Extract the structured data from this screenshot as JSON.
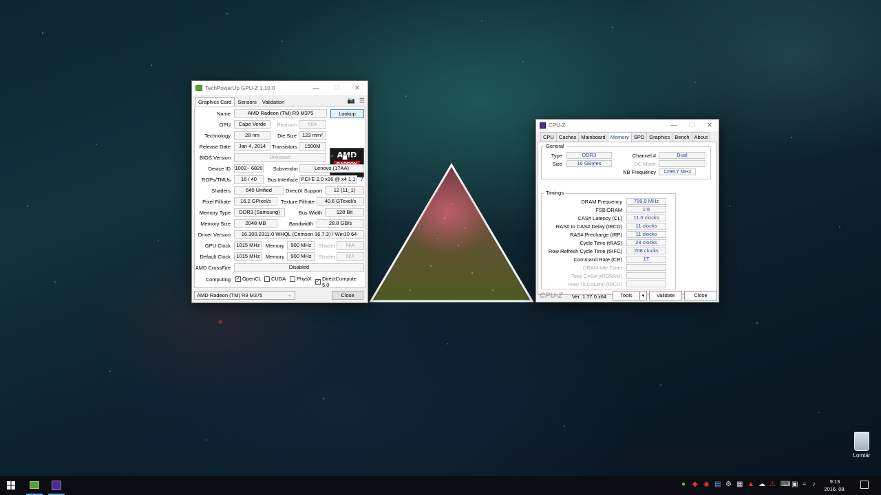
{
  "desktop": {
    "recycle_label": "Lomtár"
  },
  "gpuz": {
    "title": "TechPowerUp GPU-Z 1.10.0",
    "tabs": [
      "Graphics Card",
      "Sensors",
      "Validation"
    ],
    "lookup": "Lookup",
    "uefi": "UEFI",
    "rows": {
      "name": {
        "label": "Name",
        "value": "AMD Radeon (TM) R9 M375"
      },
      "gpu": {
        "label": "GPU",
        "value": "Cape Verde",
        "label2": "Revision",
        "value2": "N/A"
      },
      "technology": {
        "label": "Technology",
        "value": "28 nm",
        "label2": "Die Size",
        "value2": "123 mm²"
      },
      "release": {
        "label": "Release Date",
        "value": "Jan 4, 2014",
        "label2": "Transistors",
        "value2": "1500M"
      },
      "bios": {
        "label": "BIOS Version",
        "value": "Unknown"
      },
      "device": {
        "label": "Device ID",
        "value": "1002 - 6820",
        "label2": "Subvendor",
        "value2": "Lenovo (17AA)"
      },
      "rops": {
        "label": "ROPs/TMUs",
        "value": "16 / 40",
        "label2": "Bus Interface",
        "value2": "PCI-E 2.0 x16 @ x4 1.1",
        "help": "?"
      },
      "shaders": {
        "label": "Shaders",
        "value": "640 Unified",
        "label2": "DirectX Support",
        "value2": "12 (11_1)"
      },
      "pixel": {
        "label": "Pixel Fillrate",
        "value": "16.2 GPixel/s",
        "label2": "Texture Fillrate",
        "value2": "40.6 GTexel/s"
      },
      "memtype": {
        "label": "Memory Type",
        "value": "DDR3 (Samsung)",
        "label2": "Bus Width",
        "value2": "128 Bit"
      },
      "memsize": {
        "label": "Memory Size",
        "value": "2048 MB",
        "label2": "Bandwidth",
        "value2": "28.8 GB/s"
      },
      "driver": {
        "label": "Driver Version",
        "value": "16.300.2311.0 WHQL (Crimson 16.7.3) / Win10 64"
      },
      "gpuclock": {
        "label": "GPU Clock",
        "value": "1015 MHz",
        "label2": "Memory",
        "value2": "900 MHz",
        "label3": "Shader",
        "value3": "N/A"
      },
      "defclock": {
        "label": "Default Clock",
        "value": "1015 MHz",
        "label2": "Memory",
        "value2": "900 MHz",
        "label3": "Shader",
        "value3": "N/A"
      },
      "crossfire": {
        "label": "AMD CrossFire",
        "value": "Disabled"
      },
      "computing": {
        "label": "Computing",
        "opencl": "OpenCL",
        "cuda": "CUDA",
        "physx": "PhysX",
        "dc": "DirectCompute 5.0"
      }
    },
    "logo": {
      "brand": "AMD",
      "line1": "RADEON",
      "line2": "GRAPHICS"
    },
    "selected_card": "AMD Radeon (TM) R9 M375",
    "close": "Close"
  },
  "cpuz": {
    "title": "CPU-Z",
    "tabs": [
      "CPU",
      "Caches",
      "Mainboard",
      "Memory",
      "SPD",
      "Graphics",
      "Bench",
      "About"
    ],
    "general": {
      "title": "General",
      "type_label": "Type",
      "type": "DDR3",
      "size_label": "Size",
      "size": "16 GBytes",
      "channel_label": "Channel #",
      "channel": "Dual",
      "dc_label": "DC Mode",
      "dc": "",
      "nb_label": "NB Frequency",
      "nb": "1299.7 MHz"
    },
    "timings": {
      "title": "Timings",
      "rows": [
        {
          "label": "DRAM Frequency",
          "value": "799.9 MHz"
        },
        {
          "label": "FSB:DRAM",
          "value": "1:6"
        },
        {
          "label": "CAS# Latency (CL)",
          "value": "11.0 clocks"
        },
        {
          "label": "RAS# to CAS# Delay (tRCD)",
          "value": "11 clocks"
        },
        {
          "label": "RAS# Precharge (tRP)",
          "value": "11 clocks"
        },
        {
          "label": "Cycle Time (tRAS)",
          "value": "28 clocks"
        },
        {
          "label": "Row Refresh Cycle Time (tRFC)",
          "value": "208 clocks"
        },
        {
          "label": "Command Rate (CR)",
          "value": "1T"
        },
        {
          "label": "DRAM Idle Timer",
          "value": ""
        },
        {
          "label": "Total CAS# (tRDRAM)",
          "value": ""
        },
        {
          "label": "Row To Column (tRCD)",
          "value": ""
        }
      ]
    },
    "logo": "CPU-Z",
    "version": "Ver. 1.77.0.x64",
    "tools": "Tools",
    "validate": "Validate",
    "close": "Close"
  },
  "taskbar": {
    "clock_time": "9:13",
    "clock_date": "2016. 08. 18."
  }
}
